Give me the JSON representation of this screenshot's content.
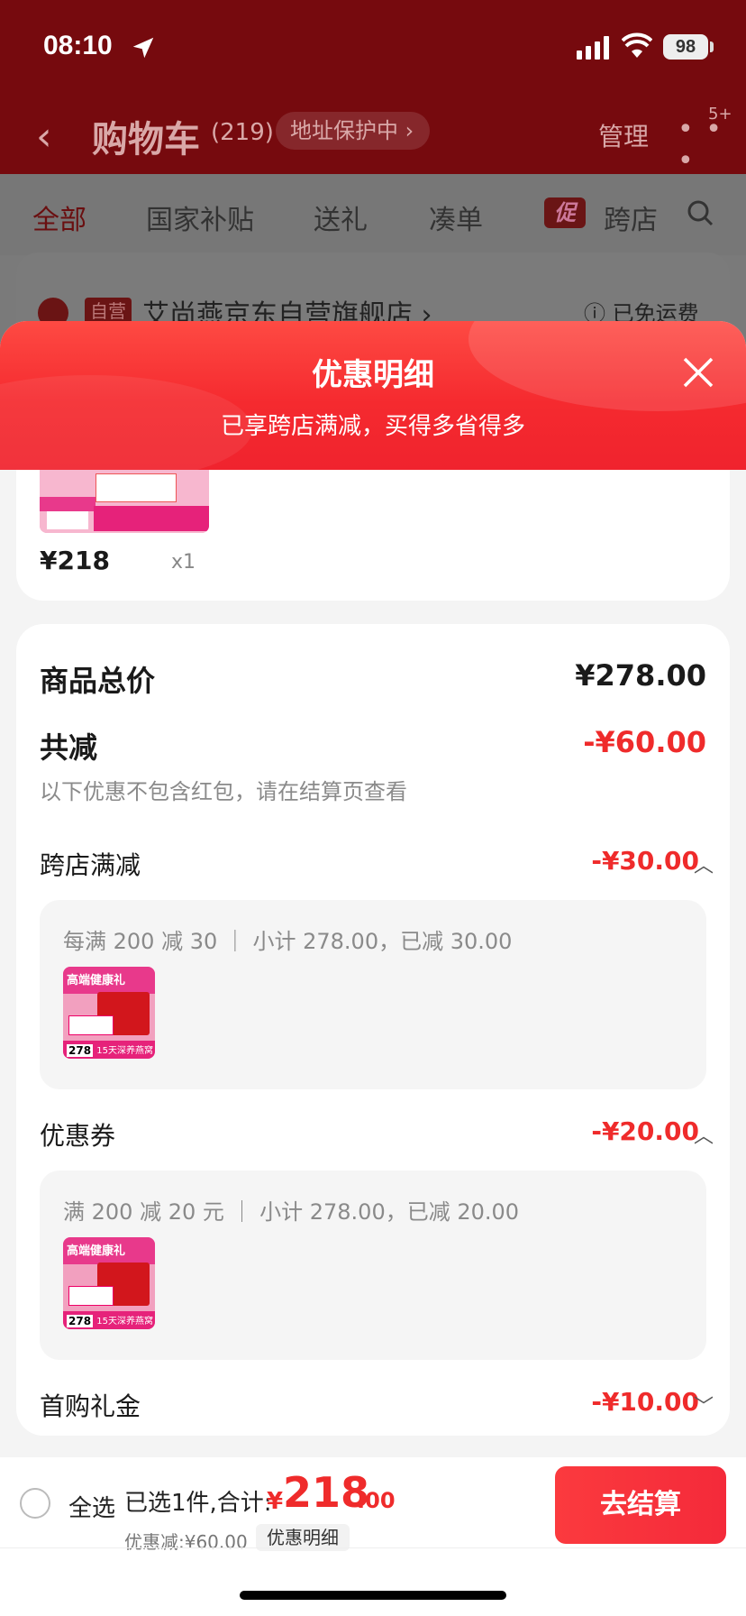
{
  "status_bar": {
    "time": "08:10",
    "battery": "98"
  },
  "nav": {
    "back_icon": "chevron-left-icon",
    "title": "购物车",
    "count": "(219)",
    "address_protect": "地址保护中 ›",
    "manage": "管理",
    "more": "• • •",
    "more_badge": "5+"
  },
  "tabs": {
    "all": "全部",
    "subsidy": "国家补贴",
    "gift": "送礼",
    "combine": "凑单",
    "promo_badge": "促",
    "cross_store": "跨店"
  },
  "store": {
    "self_tag": "自营",
    "name": "艾尚燕京东自营旗舰店 ›",
    "shipping": "ⓘ 已免运费"
  },
  "sheet": {
    "title": "优惠明细",
    "subtitle": "已享跨店满减，买得多省得多"
  },
  "item": {
    "price": "¥218",
    "qty": "x1"
  },
  "detail": {
    "total_label": "商品总价",
    "total_value": "¥278.00",
    "reduce_label": "共减",
    "reduce_value": "-¥60.00",
    "note": "以下优惠不包含红包，请在结算页查看",
    "sections": [
      {
        "label": "跨店满减",
        "value": "-¥30.00",
        "rule": "每满 200 减 30 ｜ 小计 278.00，已减 30.00",
        "expanded": true
      },
      {
        "label": "优惠券",
        "value": "-¥20.00",
        "rule": "满 200 减 20 元 ｜ 小计 278.00，已减 20.00",
        "expanded": true
      },
      {
        "label": "首购礼金",
        "value": "-¥10.00",
        "expanded": false
      }
    ]
  },
  "thumb": {
    "band_text": "高端健康礼",
    "price": "278",
    "tag": "15天深养燕窝"
  },
  "bottom": {
    "select_all": "全选",
    "selected": "已选1件,合计:",
    "currency": "¥",
    "amount_int": "218",
    "amount_dec": ".00",
    "saved": "优惠减:¥60.00",
    "detail_link": "优惠明细",
    "checkout": "去结算"
  },
  "colors": {
    "accent": "#ef2b2b",
    "header_red": "#f52a2f"
  }
}
